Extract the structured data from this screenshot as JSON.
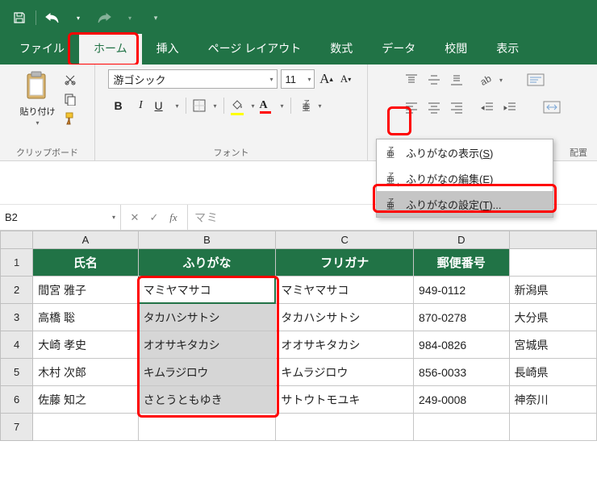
{
  "qat": {
    "save": "save",
    "undo": "undo",
    "redo": "redo"
  },
  "tabs": {
    "file": "ファイル",
    "home": "ホーム",
    "insert": "挿入",
    "page_layout": "ページ レイアウト",
    "formulas": "数式",
    "data": "データ",
    "review": "校閲",
    "view": "表示"
  },
  "ribbon": {
    "clipboard": {
      "paste": "貼り付け",
      "group": "クリップボード"
    },
    "font": {
      "name": "游ゴシック",
      "size": "11",
      "group": "フォント",
      "bold": "B",
      "italic": "I",
      "underline": "U"
    },
    "alignment": {
      "group": "配置"
    }
  },
  "furigana_menu": {
    "show": "ふりがなの表示",
    "show_key": "S",
    "edit": "ふりがなの編集",
    "edit_key": "E",
    "settings": "ふりがなの設定",
    "settings_key": "T",
    "settings_suffix": "..."
  },
  "name_box": "B2",
  "formula_preview": "マミ",
  "columns": [
    "A",
    "B",
    "C",
    "D"
  ],
  "row_numbers": [
    "1",
    "2",
    "3",
    "4",
    "5",
    "6",
    "7"
  ],
  "headers": {
    "a": "氏名",
    "b": "ふりがな",
    "c": "フリガナ",
    "d": "郵便番号"
  },
  "rows": [
    {
      "a": "間宮 雅子",
      "b": "マミヤマサコ",
      "c": "マミヤマサコ",
      "d": "949-0112",
      "e": "新潟県"
    },
    {
      "a": "高橋 聡",
      "b": "タカハシサトシ",
      "c": "タカハシサトシ",
      "d": "870-0278",
      "e": "大分県"
    },
    {
      "a": "大崎 孝史",
      "b": "オオサキタカシ",
      "c": "オオサキタカシ",
      "d": "984-0826",
      "e": "宮城県"
    },
    {
      "a": "木村 次郎",
      "b": "キムラジロウ",
      "c": "キムラジロウ",
      "d": "856-0033",
      "e": "長崎県"
    },
    {
      "a": "佐藤 知之",
      "b": "さとうともゆき",
      "c": "サトウトモユキ",
      "d": "249-0008",
      "e": "神奈川"
    }
  ]
}
